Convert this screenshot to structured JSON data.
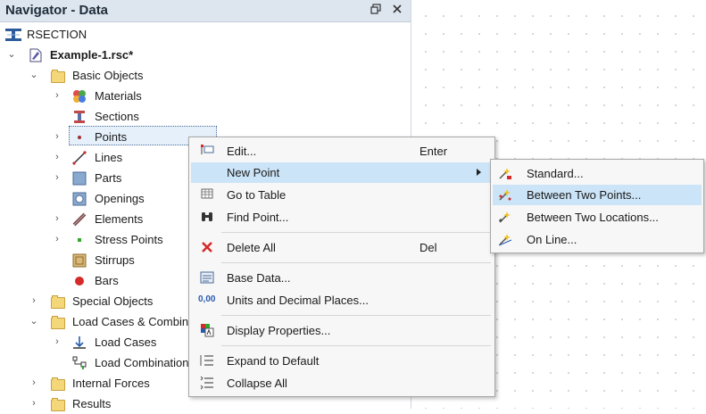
{
  "navigator": {
    "title": "Navigator - Data",
    "restore_icon": "restore-window-icon",
    "close_icon": "close-icon"
  },
  "tree": {
    "root": "RSECTION",
    "file": "Example-1.rsc*",
    "basic_objects": "Basic Objects",
    "materials": "Materials",
    "sections": "Sections",
    "points": "Points",
    "lines": "Lines",
    "parts": "Parts",
    "openings": "Openings",
    "elements": "Elements",
    "stress_points": "Stress Points",
    "stirrups": "Stirrups",
    "bars": "Bars",
    "special_objects": "Special Objects",
    "load_cases_combinations": "Load Cases & Combin",
    "load_cases": "Load Cases",
    "load_combinations": "Load Combination",
    "internal_forces": "Internal Forces",
    "results": "Results"
  },
  "context_menu": {
    "edit": "Edit...",
    "edit_shortcut": "Enter",
    "new_point": "New Point",
    "go_to_table": "Go to Table",
    "find_point": "Find Point...",
    "delete_all": "Delete All",
    "delete_shortcut": "Del",
    "base_data": "Base Data...",
    "units": "Units and Decimal Places...",
    "units_icon_text": "0,00",
    "display_properties": "Display Properties...",
    "expand": "Expand to Default",
    "collapse": "Collapse All"
  },
  "submenu": {
    "standard": "Standard...",
    "between_two_points": "Between Two Points...",
    "between_two_locations": "Between Two Locations...",
    "on_line": "On Line..."
  },
  "colors": {
    "title_bar": "#dde6ef",
    "highlight": "#cce4f7",
    "folder": "#f4d779"
  }
}
